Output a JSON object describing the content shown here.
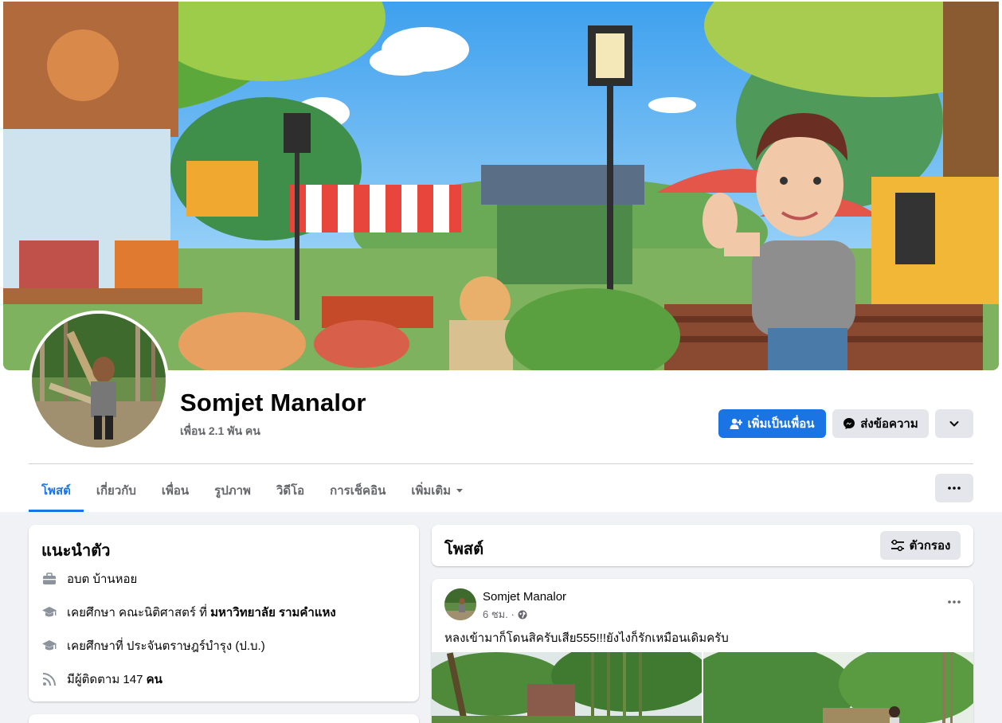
{
  "profile": {
    "name": "Somjet Manalor",
    "friends": "เพื่อน 2.1 พัน คน"
  },
  "actions": {
    "add_friend": "เพิ่มเป็นเพื่อน",
    "message": "ส่งข้อความ"
  },
  "tabs": [
    {
      "label": "โพสต์",
      "active": true
    },
    {
      "label": "เกี่ยวกับ"
    },
    {
      "label": "เพื่อน"
    },
    {
      "label": "รูปภาพ"
    },
    {
      "label": "วิดีโอ"
    },
    {
      "label": "การเช็คอิน"
    },
    {
      "label": "เพิ่มเติม"
    }
  ],
  "intro": {
    "title": "แนะนำตัว",
    "work": "อบต บ้านหอย",
    "education1_prefix": "เคยศึกษา คณะนิติศาสตร์ ที่ ",
    "education1_school": "มหาวิทยาลัย รามคำแหง",
    "education2": "เคยศึกษาที่ ประจันตราษฎร์บำรุง (ป.บ.)",
    "followers_prefix": "มีผู้ติดตาม 147 ",
    "followers_suffix": "คน"
  },
  "posts": {
    "title": "โพสต์",
    "filter_label": "ตัวกรอง"
  },
  "post": {
    "author": "Somjet Manalor",
    "time": "6 ชม. ·",
    "text": "หลงเข้ามาก็โดนสิครับเสีย555!!!ยังไงก็รักเหมือนเดิมครับ"
  },
  "colors": {
    "accent": "#1b74e4",
    "background": "#f0f2f5",
    "secondary_button": "#e4e6eb"
  }
}
